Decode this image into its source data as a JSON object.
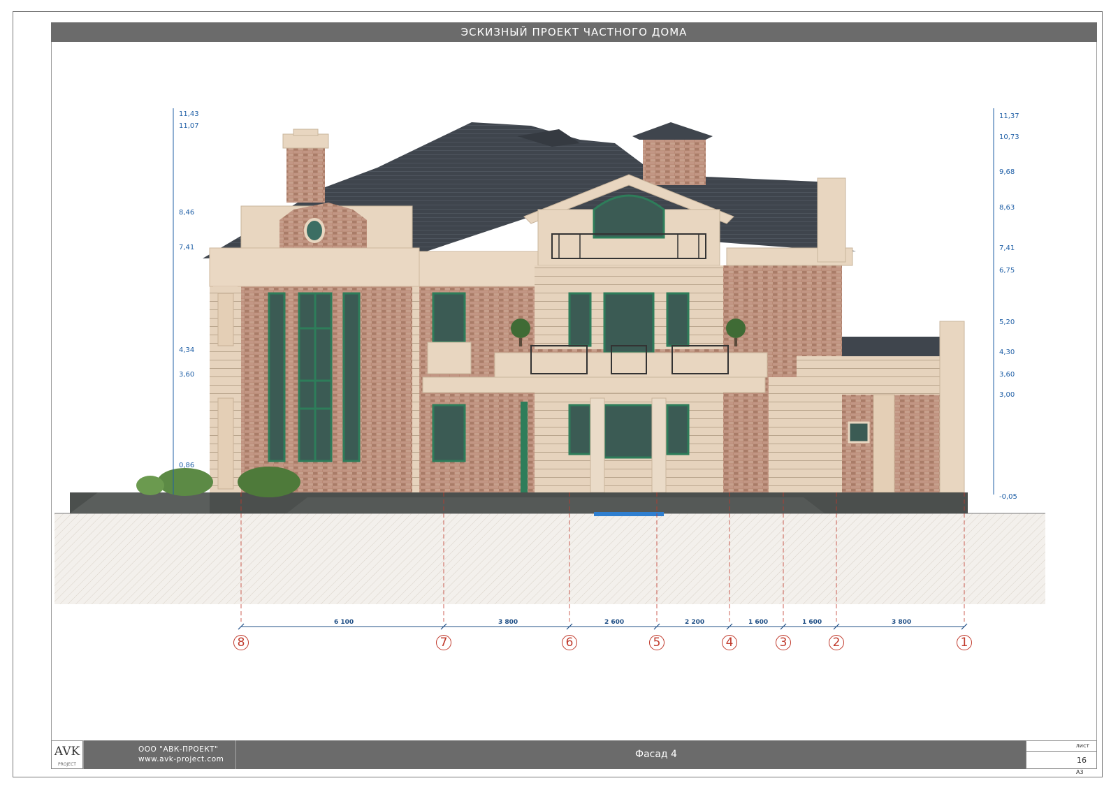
{
  "header": {
    "title": "ЭСКИЗНЫЙ ПРОЕКТ ЧАСТНОГО ДОМА"
  },
  "stamp": {
    "logo_text": "AVK",
    "logo_subtext": "PROJECT",
    "company_name": "ООО \"АВК-ПРОЕКТ\"",
    "company_site": "www.avk-project.com",
    "sheet_name": "Фасад 4",
    "sheet_label": "лист",
    "sheet_number": "16",
    "format": "А3"
  },
  "levels_left": [
    "11,43",
    "11,07",
    "8,46",
    "7,41",
    "4,34",
    "3,60",
    "0,86"
  ],
  "levels_right": [
    "11,37",
    "10,73",
    "9,68",
    "8,63",
    "7,41",
    "6,75",
    "5,20",
    "4,30",
    "3,60",
    "3,00",
    "-0,05"
  ],
  "axes": [
    "8",
    "7",
    "6",
    "5",
    "4",
    "3",
    "2",
    "1"
  ],
  "dimensions": [
    "6 100",
    "3 800",
    "2 600",
    "2 200",
    "1 600",
    "1 600",
    "3 800"
  ],
  "colors": {
    "bar": "#6b6b6b",
    "roof": "#3f454d",
    "brick": "#b98a75",
    "stucco": "#e8d6c0",
    "frames": "#2e7d5a",
    "axis": "#c0392b",
    "level": "#1f5fa6",
    "ground": "#eeeae4"
  }
}
